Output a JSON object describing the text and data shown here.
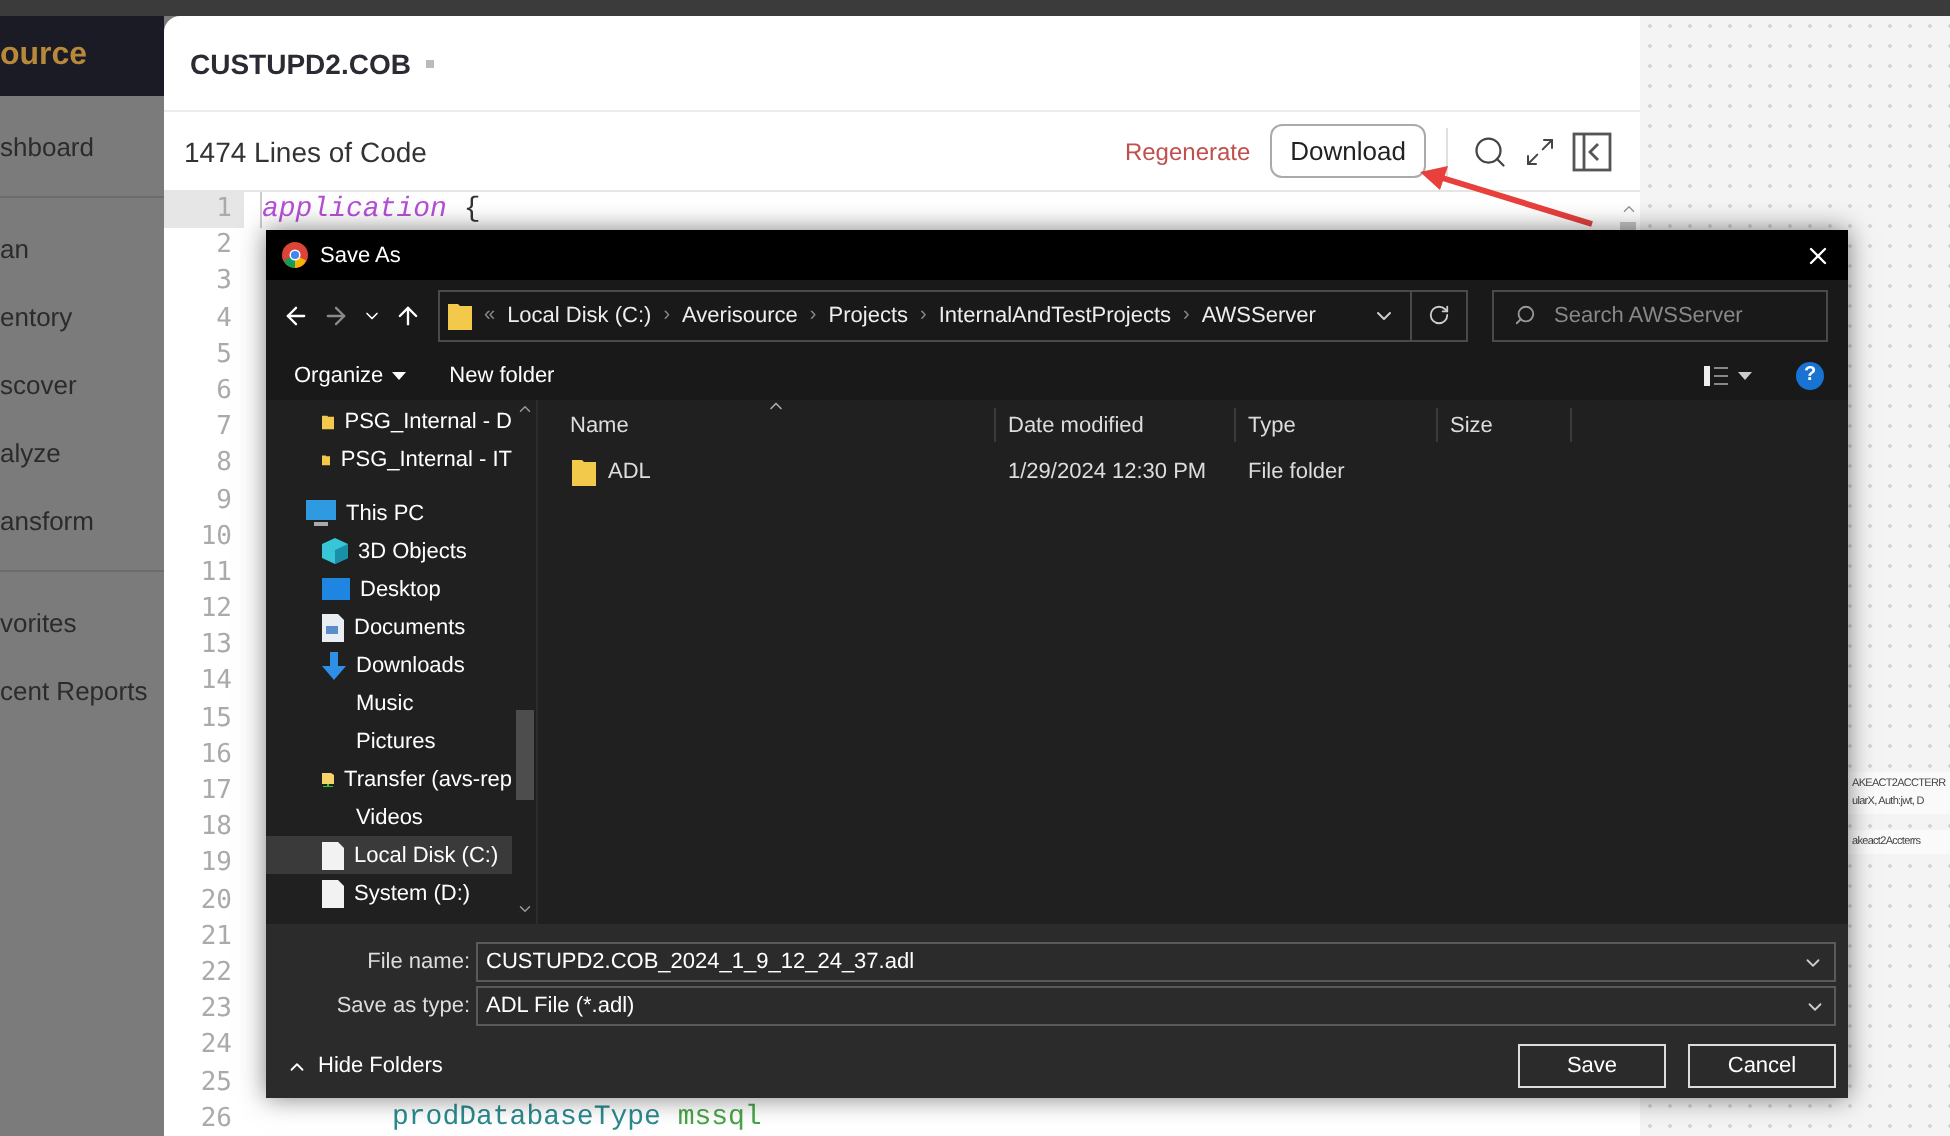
{
  "sidebar": {
    "brand": "ource",
    "groups": [
      {
        "items": [
          {
            "label": "shboard"
          }
        ]
      },
      {
        "items": [
          {
            "label": "an"
          },
          {
            "label": "entory"
          },
          {
            "label": "scover"
          },
          {
            "label": "alyze"
          },
          {
            "label": "ansform"
          }
        ]
      },
      {
        "items": [
          {
            "label": "vorites"
          },
          {
            "label": "cent Reports"
          }
        ]
      }
    ]
  },
  "editor": {
    "title": "CUSTUPD2.COB",
    "line_count": "1474 Lines of Code",
    "regenerate": "Regenerate",
    "download": "Download",
    "lines": [
      {
        "number": "1",
        "current": true,
        "segments": [
          {
            "text": "application",
            "kind": "keyword"
          },
          {
            "text": " {",
            "kind": "plain"
          }
        ]
      },
      {
        "number": "2",
        "current": false
      },
      {
        "number": "3",
        "current": false
      },
      {
        "number": "4",
        "current": false
      },
      {
        "number": "5",
        "current": false
      },
      {
        "number": "6",
        "current": false
      },
      {
        "number": "7",
        "current": false
      },
      {
        "number": "8",
        "current": false
      },
      {
        "number": "9",
        "current": false
      },
      {
        "number": "10",
        "current": false
      },
      {
        "number": "11",
        "current": false
      },
      {
        "number": "12",
        "current": false
      },
      {
        "number": "13",
        "current": false
      },
      {
        "number": "14",
        "current": false
      },
      {
        "number": "15",
        "current": false
      },
      {
        "number": "16",
        "current": false
      },
      {
        "number": "17",
        "current": false
      },
      {
        "number": "18",
        "current": false
      },
      {
        "number": "19",
        "current": false
      },
      {
        "number": "20",
        "current": false
      },
      {
        "number": "21",
        "current": false
      },
      {
        "number": "22",
        "current": false
      },
      {
        "number": "23",
        "current": false
      },
      {
        "number": "24",
        "current": false
      },
      {
        "number": "25",
        "current": false
      },
      {
        "number": "26",
        "current": false,
        "segments": [
          {
            "text": "prodDatabaseType",
            "kind": "property"
          },
          {
            "text": " mssql",
            "kind": "value"
          }
        ]
      }
    ]
  },
  "canvas": {
    "labels": [
      "AKEACT2ACCTERR",
      "ularX, Auth:jwt, D",
      "akeact2Accterrs"
    ]
  },
  "dialog": {
    "title": "Save As",
    "overflow": "«",
    "separator": "›",
    "breadcrumb": [
      "Local Disk (C:)",
      "Averisource",
      "Projects",
      "InternalAndTestProjects",
      "AWSServer"
    ],
    "search": {
      "placeholder": "Search AWSServer"
    },
    "organize": "Organize",
    "new_folder": "New folder",
    "help": "?",
    "nav": [
      {
        "label": "PSG_Internal - D",
        "kind": "folder",
        "selected": false
      },
      {
        "label": "PSG_Internal - IT",
        "kind": "folder",
        "selected": false
      },
      {
        "label": "This PC",
        "kind": "computer",
        "selected": false,
        "children": [
          {
            "label": "3D Objects",
            "kind": "cube",
            "selected": false
          },
          {
            "label": "Desktop",
            "kind": "desktop",
            "selected": false
          },
          {
            "label": "Documents",
            "kind": "document",
            "selected": false
          },
          {
            "label": "Downloads",
            "kind": "download",
            "selected": false
          },
          {
            "label": "Music",
            "kind": "plain",
            "selected": false
          },
          {
            "label": "Pictures",
            "kind": "plain",
            "selected": false
          },
          {
            "label": "Transfer (avs-rep",
            "kind": "network",
            "selected": false
          },
          {
            "label": "Videos",
            "kind": "plain",
            "selected": false
          },
          {
            "label": "Local Disk (C:)",
            "kind": "drive",
            "selected": true
          },
          {
            "label": "System (D:)",
            "kind": "drive",
            "selected": false
          }
        ]
      }
    ],
    "columns": [
      "Name",
      "Date modified",
      "Type",
      "Size"
    ],
    "rows": [
      {
        "name": "ADL",
        "date": "1/29/2024 12:30 PM",
        "type": "File folder"
      }
    ],
    "file_name": {
      "label": "File name:",
      "value": "CUSTUPD2.COB_2024_1_9_12_24_37.adl"
    },
    "save_type": {
      "label": "Save as type:",
      "value": "ADL File (*.adl)"
    },
    "hide_folders": "Hide Folders",
    "save": "Save",
    "cancel": "Cancel"
  }
}
